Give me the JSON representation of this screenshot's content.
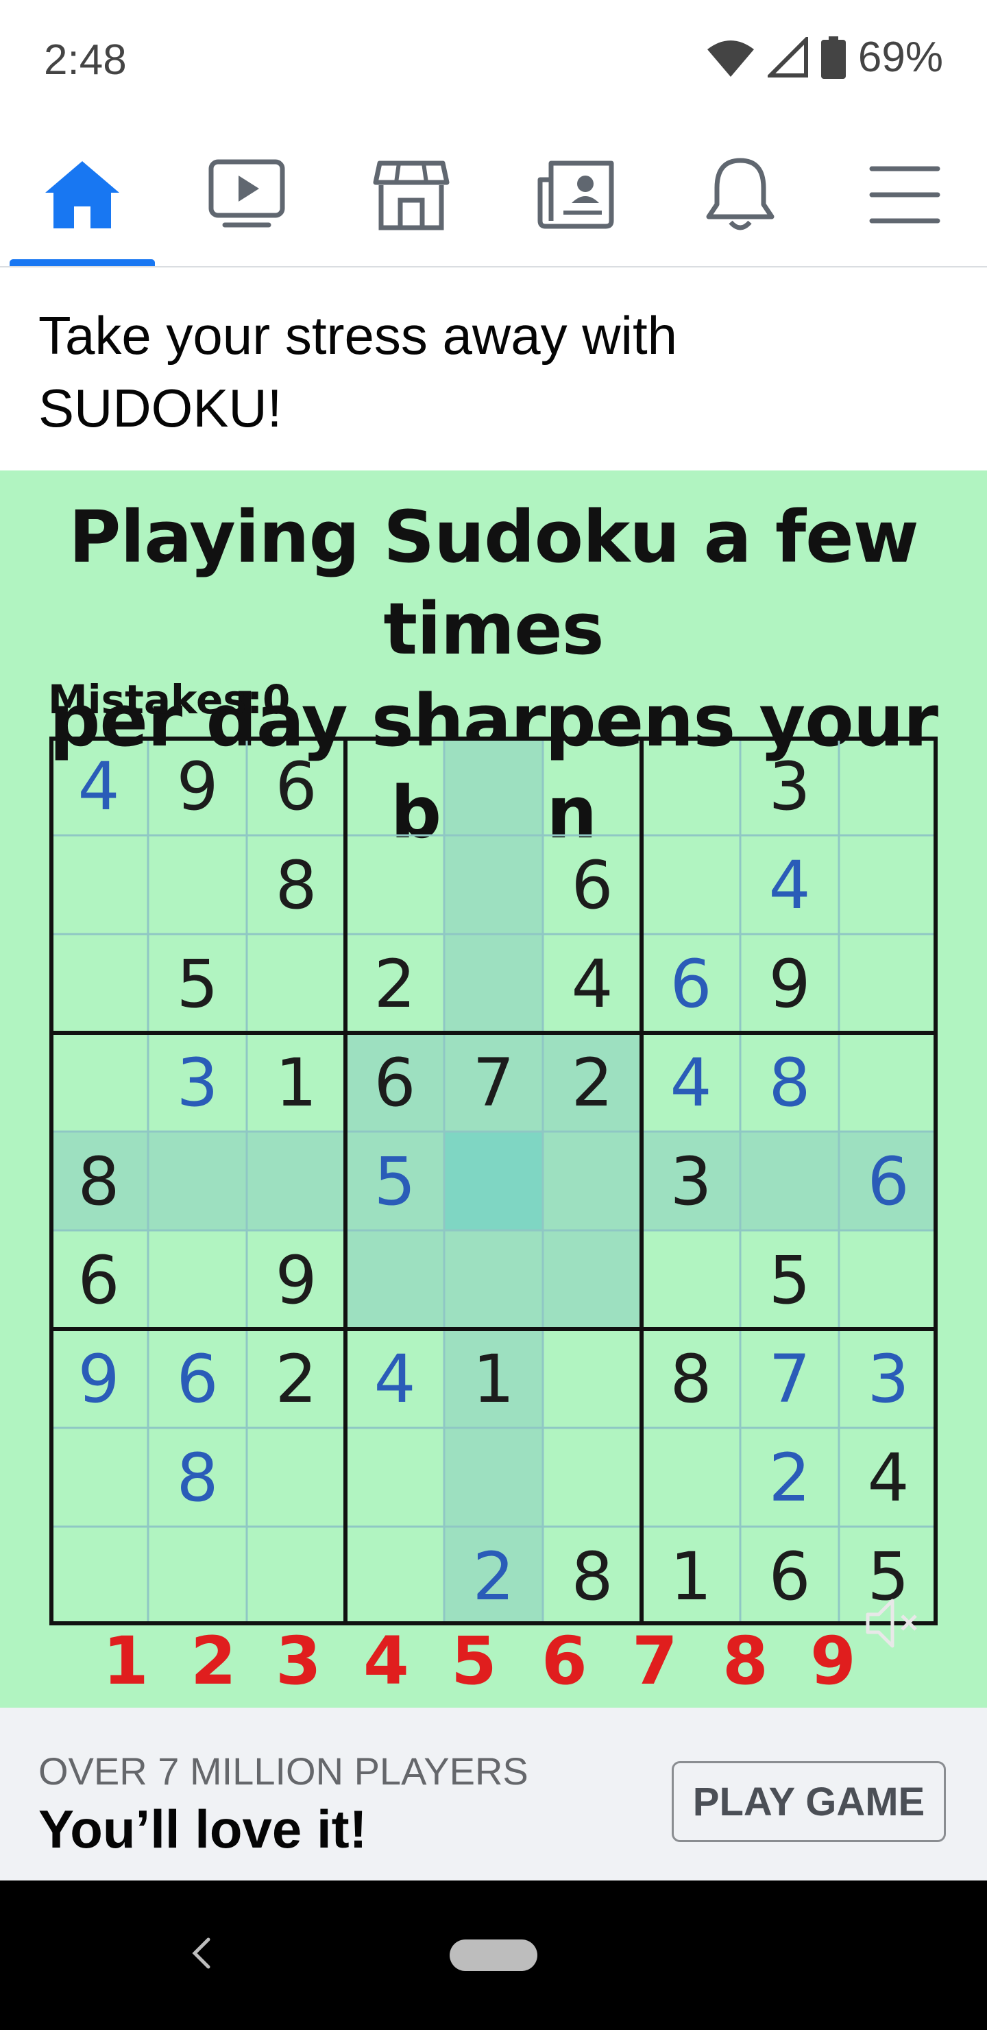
{
  "status_bar": {
    "time": "2:48",
    "battery": "69%"
  },
  "nav": {
    "tabs": [
      {
        "name": "home",
        "icon": "home-icon",
        "active": true
      },
      {
        "name": "watch",
        "icon": "video-icon"
      },
      {
        "name": "marketplace",
        "icon": "marketplace-icon"
      },
      {
        "name": "news",
        "icon": "news-icon"
      },
      {
        "name": "notifications",
        "icon": "bell-icon"
      },
      {
        "name": "menu",
        "icon": "menu-icon"
      }
    ],
    "accent": "#1877f2"
  },
  "post": {
    "text": "Take your stress away with SUDOKU!"
  },
  "ad": {
    "headline_line1": "Playing Sudoku a few times",
    "headline_line2": "per day sharpens your brain",
    "mistakes": "Mistakes:0",
    "background": "#b1f4c1",
    "grid": [
      [
        "4",
        "9",
        "6",
        "",
        "",
        "",
        "",
        "3",
        ""
      ],
      [
        "",
        "",
        "8",
        "",
        "",
        "6",
        "",
        "4",
        ""
      ],
      [
        "",
        "5",
        "",
        "2",
        "",
        "4",
        "6",
        "9",
        ""
      ],
      [
        "",
        "3",
        "1",
        "6",
        "7",
        "2",
        "4",
        "8",
        ""
      ],
      [
        "8",
        "",
        "",
        "5",
        "",
        "",
        "3",
        "",
        "6"
      ],
      [
        "6",
        "",
        "9",
        "",
        "",
        "",
        "",
        "5",
        ""
      ],
      [
        "9",
        "6",
        "2",
        "4",
        "1",
        "",
        "8",
        "7",
        "3"
      ],
      [
        "",
        "8",
        "",
        "",
        "",
        "",
        "",
        "2",
        "4"
      ],
      [
        "",
        "",
        "",
        "",
        "2",
        "8",
        "1",
        "6",
        "5"
      ]
    ],
    "blue_cells": [
      [
        0,
        0
      ],
      [
        1,
        7
      ],
      [
        2,
        6
      ],
      [
        3,
        1
      ],
      [
        3,
        6
      ],
      [
        3,
        7
      ],
      [
        4,
        3
      ],
      [
        4,
        8
      ],
      [
        6,
        0
      ],
      [
        6,
        1
      ],
      [
        6,
        3
      ],
      [
        6,
        7
      ],
      [
        6,
        8
      ],
      [
        7,
        1
      ],
      [
        7,
        7
      ],
      [
        8,
        4
      ]
    ],
    "number_keys": [
      "1",
      "2",
      "3",
      "4",
      "5",
      "6",
      "7",
      "8",
      "9"
    ]
  },
  "cta": {
    "subtitle": "OVER 7 MILLION PLAYERS",
    "title": "You’ll love it!",
    "button": "PLAY GAME"
  }
}
